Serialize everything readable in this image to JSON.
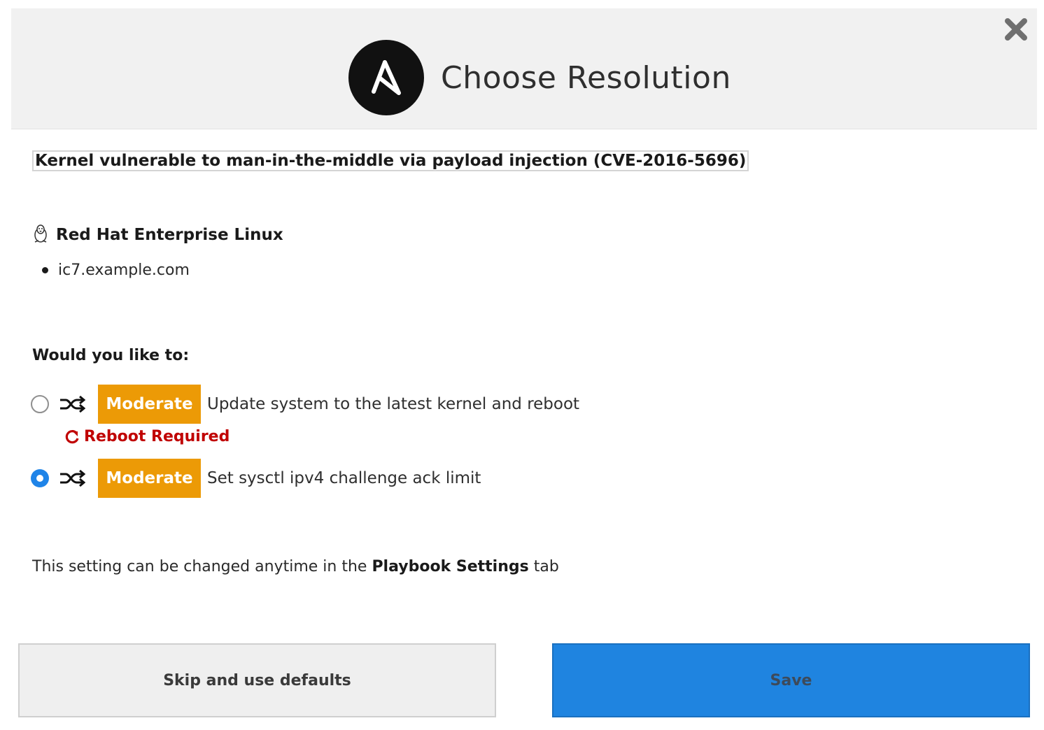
{
  "header": {
    "title": "Choose Resolution",
    "logo_icon": "ansible-logo-icon",
    "close_icon": "close-icon"
  },
  "issue": {
    "title": "Kernel vulnerable to man-in-the-middle via payload injection (CVE-2016-5696)"
  },
  "system": {
    "os_icon": "linux-penguin-icon",
    "os_name": "Red Hat Enterprise Linux",
    "hosts": [
      "ic7.example.com"
    ]
  },
  "question": "Would you like to:",
  "options": [
    {
      "selected": false,
      "icon": "shuffle-icon",
      "risk": "Moderate",
      "label": "Update system to the latest kernel and reboot",
      "reboot_note": "Reboot Required"
    },
    {
      "selected": true,
      "icon": "shuffle-icon",
      "risk": "Moderate",
      "label": "Set sysctl ipv4 challenge ack limit"
    }
  ],
  "footer": {
    "note_prefix": "This setting can be changed anytime in the",
    "note_bold": "Playbook Settings",
    "note_suffix": "tab"
  },
  "buttons": {
    "skip_label": "Skip and use defaults",
    "save_label": "Save"
  },
  "colors": {
    "header_bg": "#f1f1f1",
    "badge_moderate": "#ec9a06",
    "reboot_red": "#c00000",
    "radio_selected": "#1f84e8",
    "save_blue": "#1f84e0"
  }
}
